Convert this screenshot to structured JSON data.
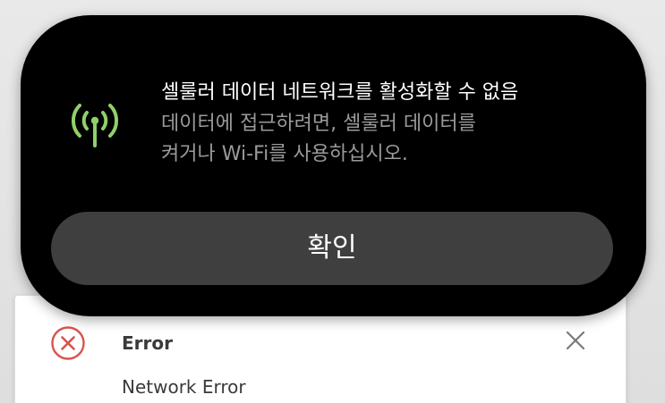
{
  "alert": {
    "title": "셀룰러 데이터 네트워크를 활성화할 수 없음",
    "body_line1": "데이터에 접근하려면, 셀룰러 데이터를",
    "body_line2": "켜거나 Wi-Fi를 사용하십시오.",
    "confirm_label": "확인",
    "icon": "cellular-antenna-icon",
    "icon_color": "#8fd06a"
  },
  "error_toast": {
    "title": "Error",
    "message": "Network Error",
    "icon": "error-x-circle-icon",
    "icon_color": "#d9534f",
    "close_icon": "close-icon"
  }
}
